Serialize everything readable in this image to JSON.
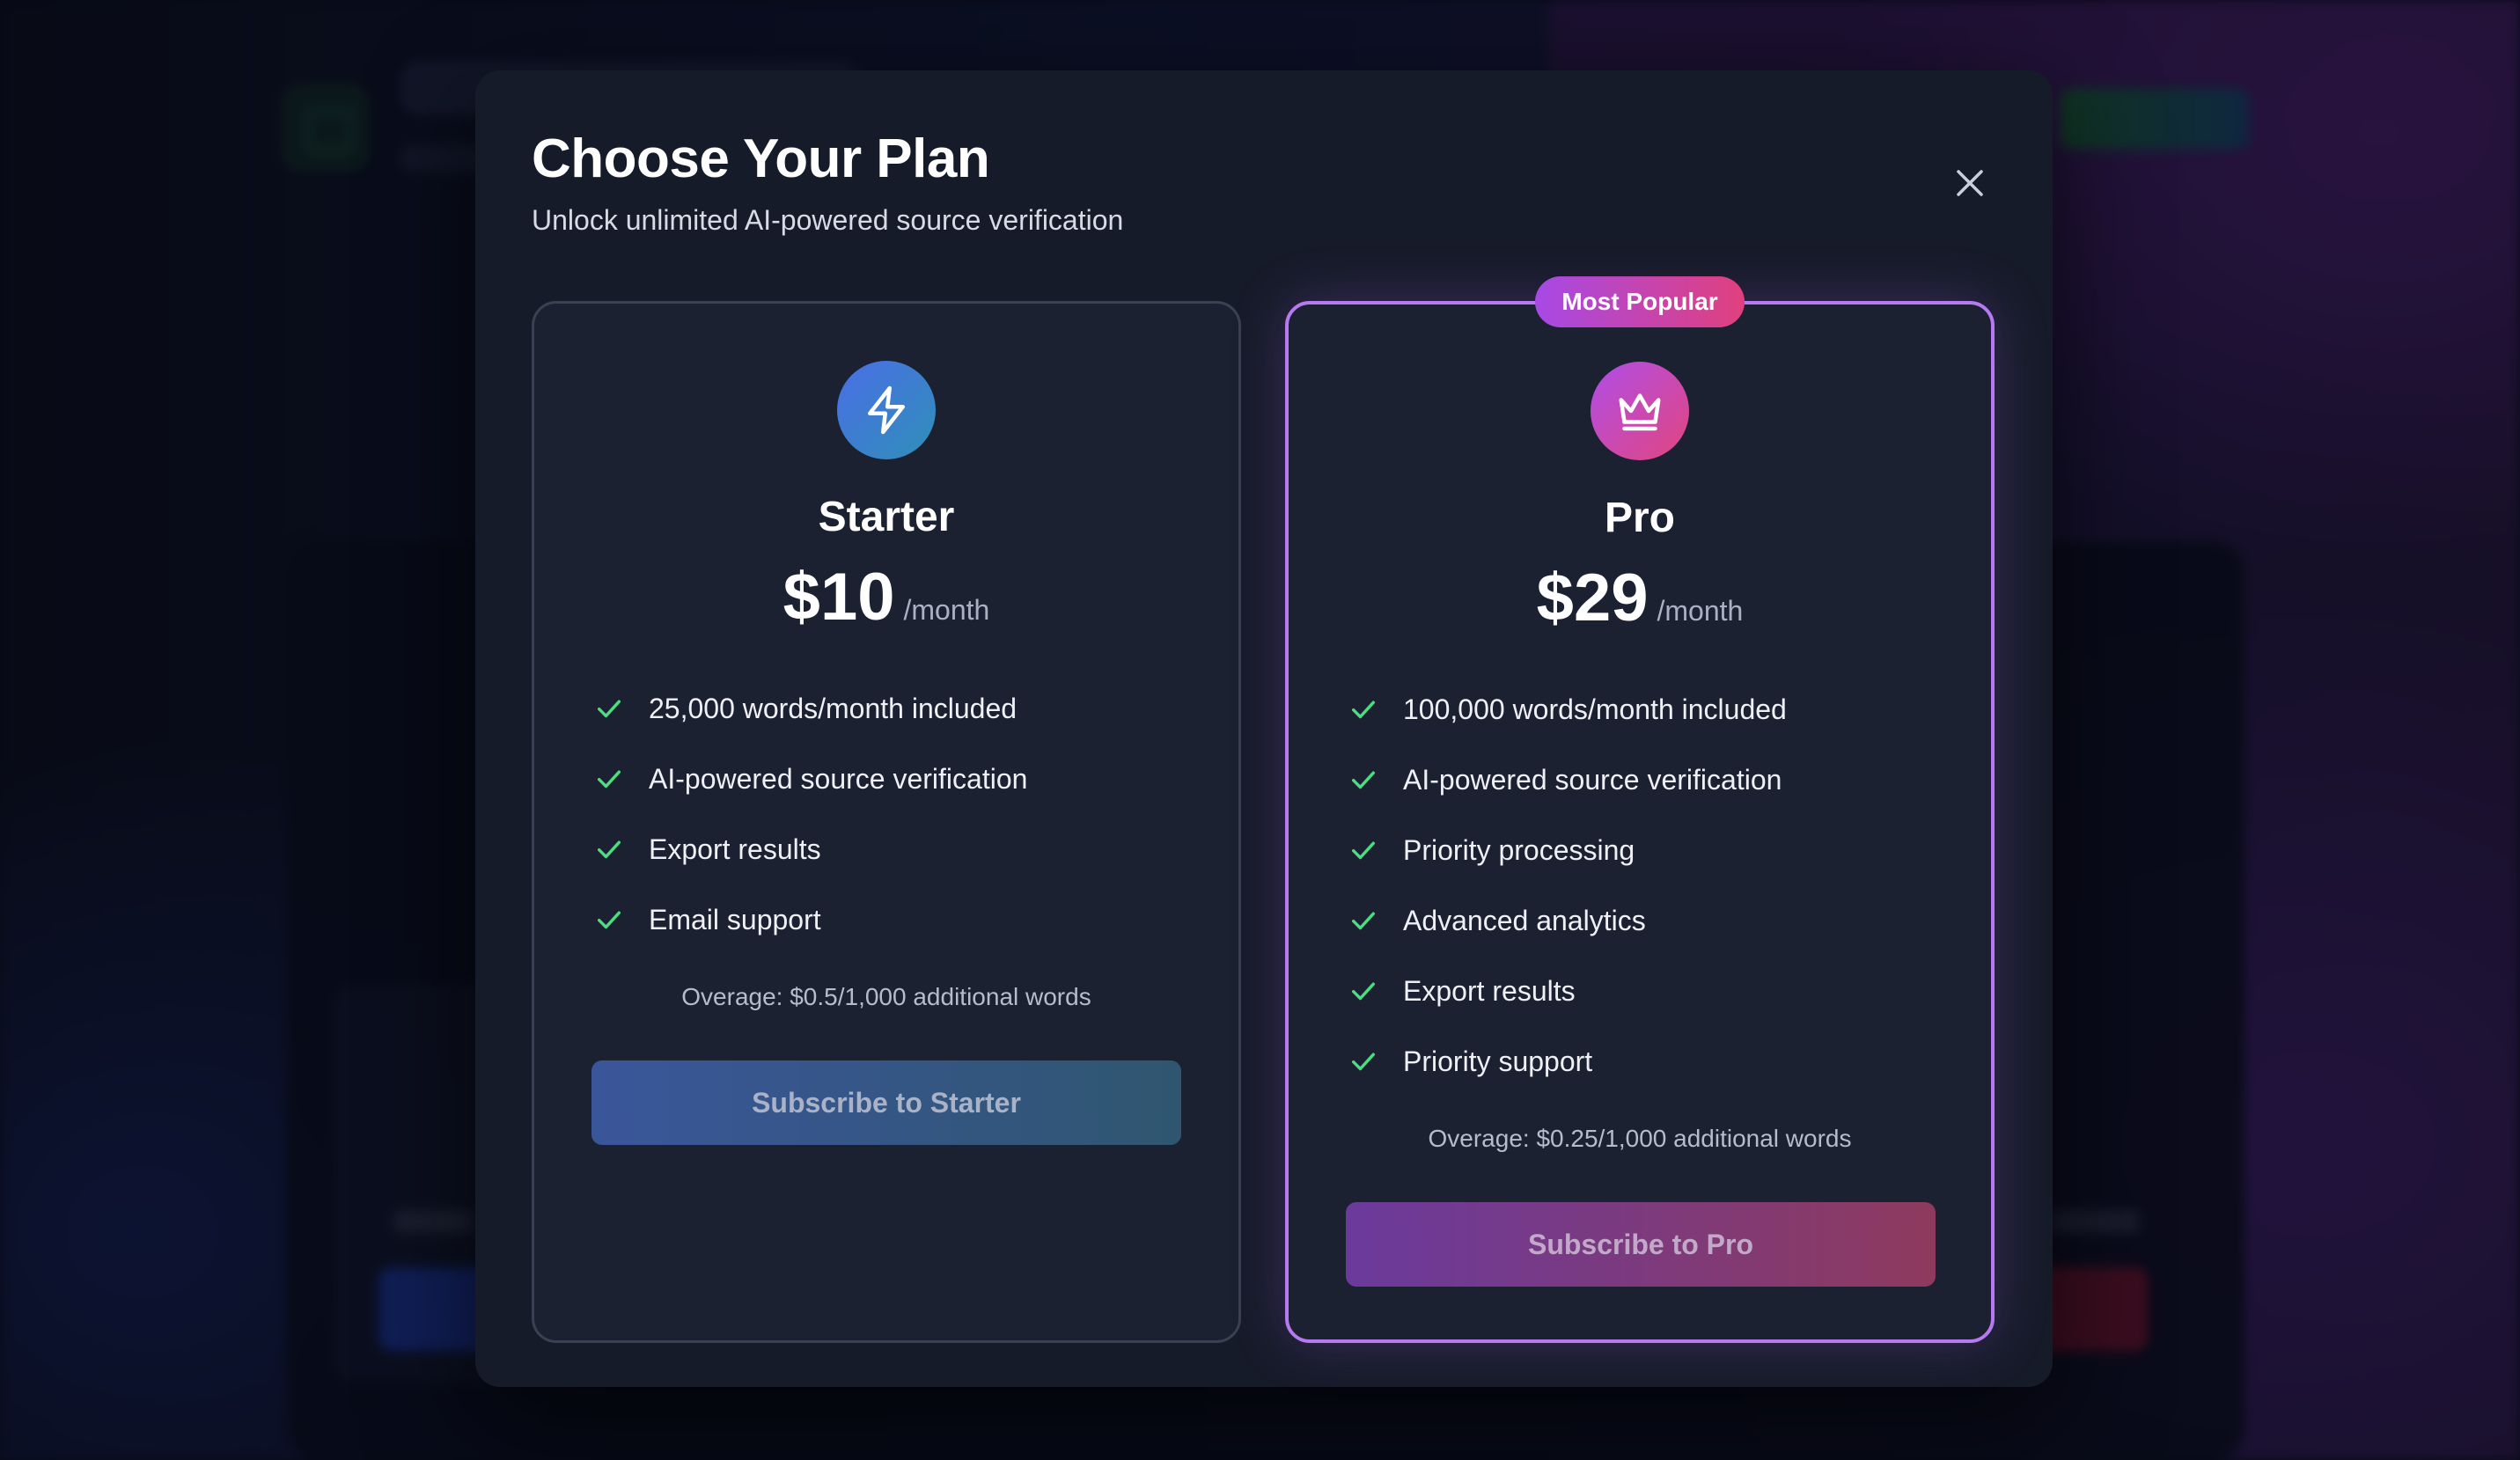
{
  "modal": {
    "title": "Choose Your Plan",
    "subtitle": "Unlock unlimited AI-powered source verification",
    "close_icon": "close-icon"
  },
  "plans": [
    {
      "name": "Starter",
      "icon": "lightning-icon",
      "price": "$10",
      "period": "/month",
      "features": [
        "25,000 words/month included",
        "AI-powered source verification",
        "Export results",
        "Email support"
      ],
      "overage": "Overage: $0.5/1,000 additional words",
      "button_label": "Subscribe to Starter",
      "accent": "#4a6ee6"
    },
    {
      "name": "Pro",
      "icon": "crown-icon",
      "badge": "Most Popular",
      "price": "$29",
      "period": "/month",
      "features": [
        "100,000 words/month included",
        "AI-powered source verification",
        "Priority processing",
        "Advanced analytics",
        "Export results",
        "Priority support"
      ],
      "overage": "Overage: $0.25/1,000 additional words",
      "button_label": "Subscribe to Pro",
      "accent": "#b57af0"
    }
  ],
  "colors": {
    "check": "#4ade80",
    "modal_bg": "#161b29",
    "pro_border": "#b57af0"
  }
}
